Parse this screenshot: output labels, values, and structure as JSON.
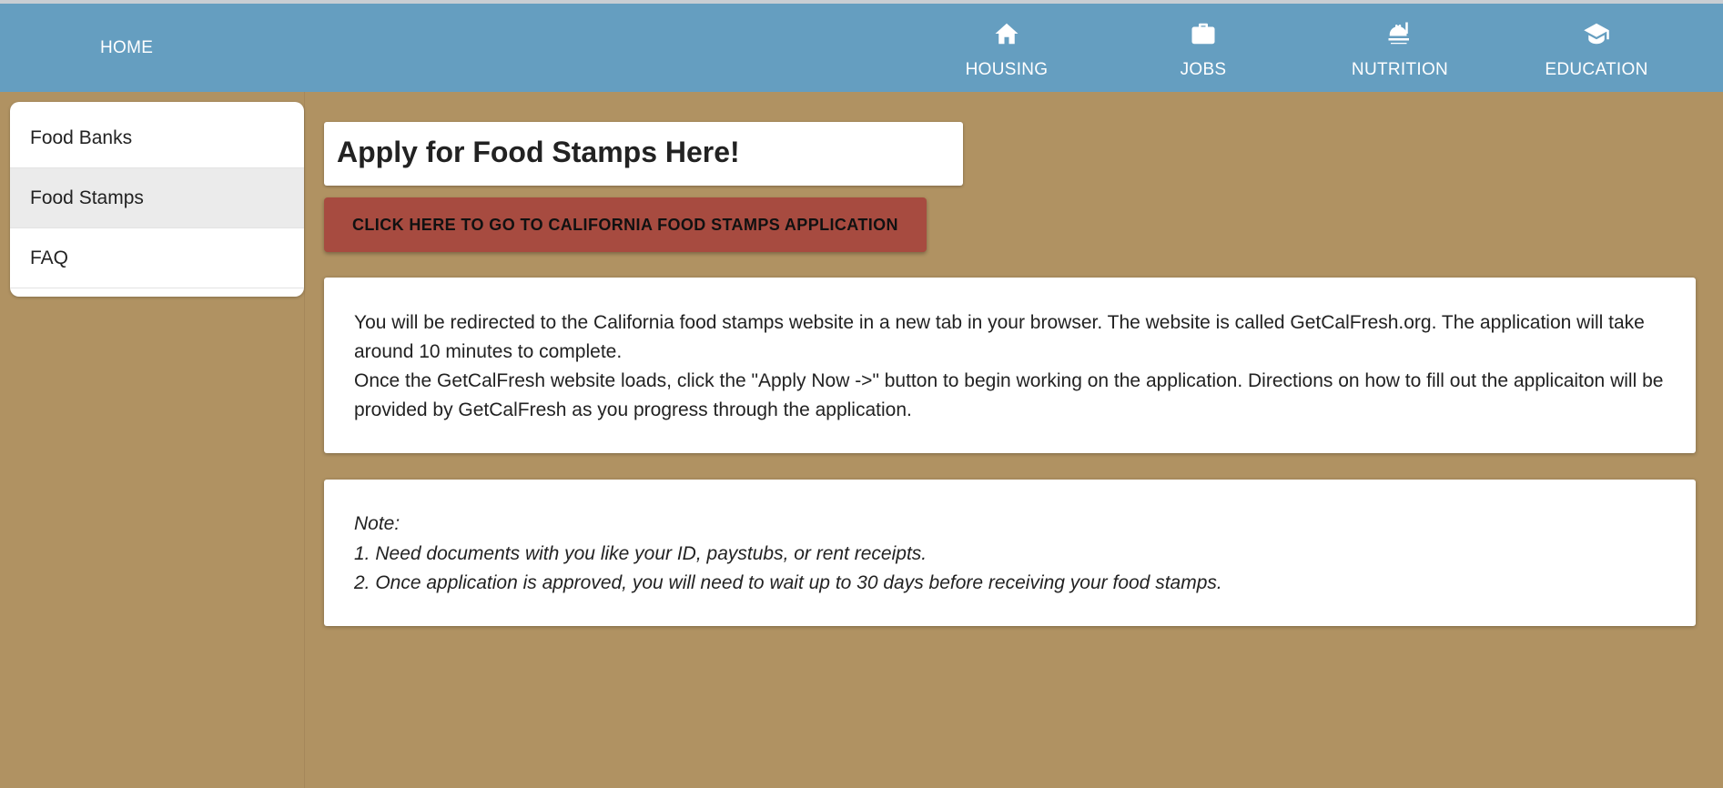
{
  "nav": {
    "home_label": "HOME",
    "items": [
      {
        "label": "HOUSING",
        "icon": "home-icon"
      },
      {
        "label": "JOBS",
        "icon": "briefcase-icon"
      },
      {
        "label": "NUTRITION",
        "icon": "food-service-icon"
      },
      {
        "label": "EDUCATION",
        "icon": "graduation-cap-icon"
      }
    ]
  },
  "sidebar": {
    "items": [
      {
        "label": "Food Banks",
        "active": false
      },
      {
        "label": "Food Stamps",
        "active": true
      },
      {
        "label": "FAQ",
        "active": false
      }
    ]
  },
  "main": {
    "title": "Apply for Food Stamps Here!",
    "apply_button_label": "CLICK HERE TO GO TO CALIFORNIA FOOD STAMPS APPLICATION",
    "info": {
      "paragraph_1": "You will be redirected to the California food stamps website in a new tab in your browser. The website is called GetCalFresh.org. The application will take around 10 minutes to complete.",
      "paragraph_2": "Once the GetCalFresh website loads, click the \"Apply Now ->\" button to begin working on the application. Directions on how to fill out the applicaiton will be provided by GetCalFresh as you progress through the application."
    },
    "note": {
      "heading": "Note:",
      "items": [
        "1. Need documents with you like your ID, paystubs, or rent receipts.",
        "2. Once application is approved, you will need to wait up to 30 days before receiving your food stamps."
      ]
    }
  },
  "colors": {
    "navbar": "#659ec0",
    "background": "#b09262",
    "apply_button": "#a74b40"
  }
}
